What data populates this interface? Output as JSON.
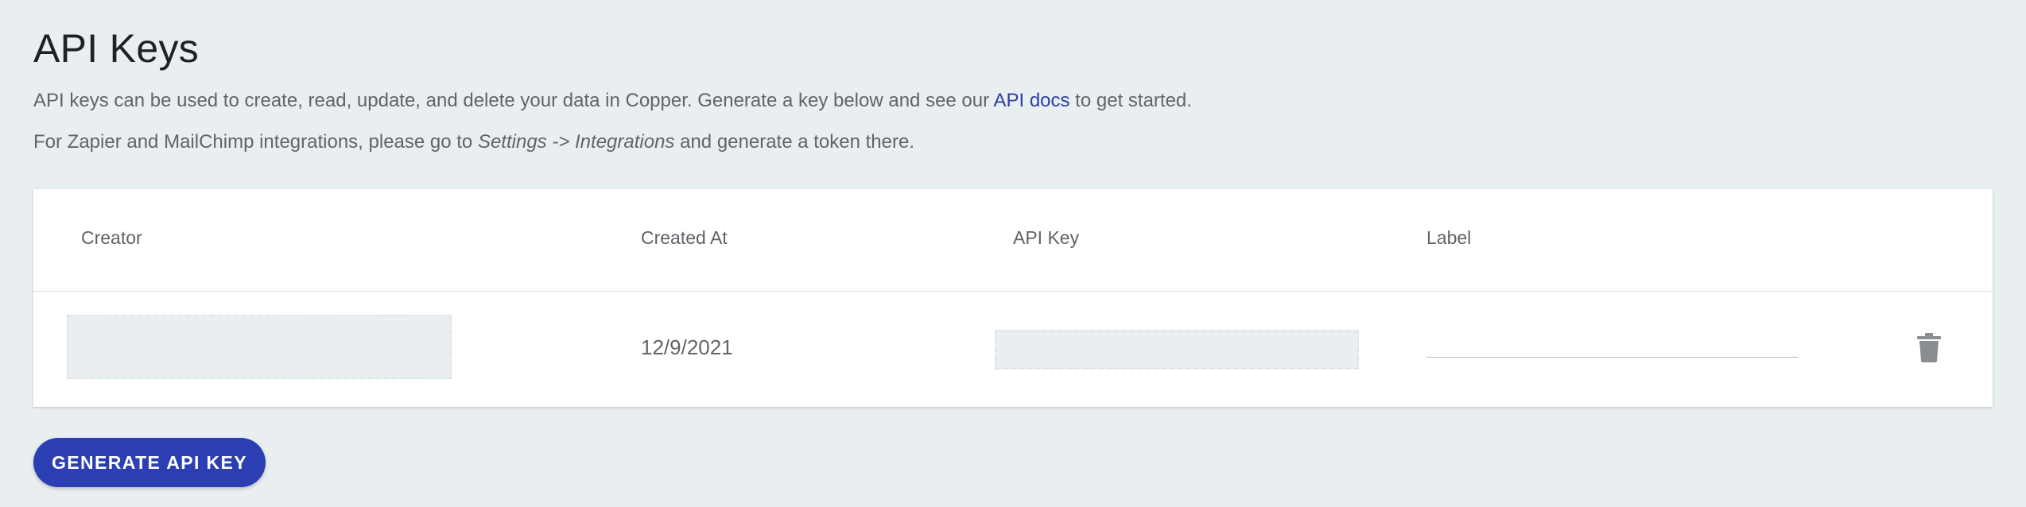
{
  "page": {
    "title": "API Keys",
    "description_line1_before": "API keys can be used to create, read, update, and delete your data in Copper. Generate a key below and see our ",
    "description_line1_link": "API docs",
    "description_line1_after": " to get started.",
    "description_line2_before": "For Zapier and MailChimp integrations, please go to ",
    "description_line2_italic": "Settings -> Integrations",
    "description_line2_after": " and generate a token there."
  },
  "table": {
    "columns": {
      "creator": "Creator",
      "created_at": "Created At",
      "api_key": "API Key",
      "label": "Label"
    },
    "rows": [
      {
        "creator": "",
        "created_at": "12/9/2021",
        "api_key": "",
        "label": ""
      }
    ],
    "delete_icon": "trash-icon"
  },
  "actions": {
    "generate_label": "GENERATE API KEY"
  },
  "colors": {
    "background": "#e9eef1",
    "accent": "#2b3fb2",
    "link": "#2b3fa8",
    "redacted": "#e9eef1"
  }
}
